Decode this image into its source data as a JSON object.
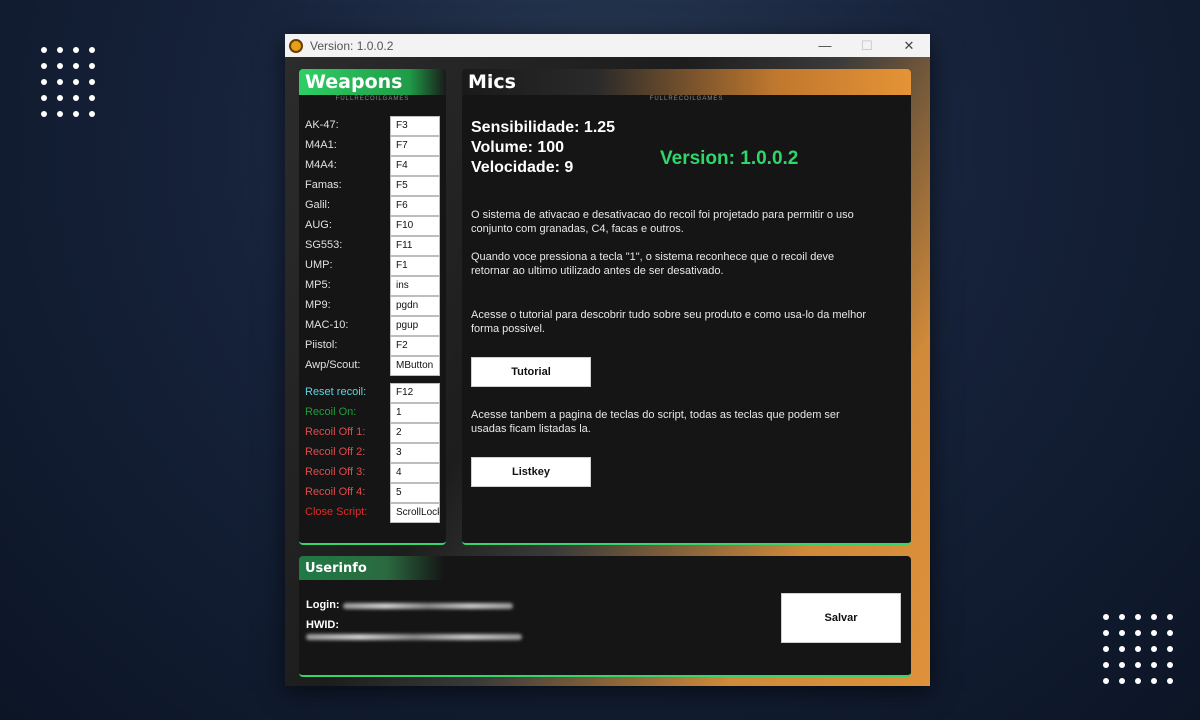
{
  "window": {
    "title": "Version: 1.0.0.2",
    "controls": {
      "minimize": "—",
      "maximize": "☐",
      "close": "✕"
    }
  },
  "weapons": {
    "title": "Weapons",
    "brand": "FULLRECOILGAMES",
    "items": [
      {
        "label": "AK-47:",
        "key": "F3"
      },
      {
        "label": "M4A1:",
        "key": "F7"
      },
      {
        "label": "M4A4:",
        "key": "F4"
      },
      {
        "label": "Famas:",
        "key": "F5"
      },
      {
        "label": "Galil:",
        "key": "F6"
      },
      {
        "label": "AUG:",
        "key": "F10"
      },
      {
        "label": "SG553:",
        "key": "F11"
      },
      {
        "label": "UMP:",
        "key": "F1"
      },
      {
        "label": "MP5:",
        "key": "ins"
      },
      {
        "label": "MP9:",
        "key": "pgdn"
      },
      {
        "label": "MAC-10:",
        "key": "pgup"
      },
      {
        "label": "Piistol:",
        "key": "F2"
      },
      {
        "label": "Awp/Scout:",
        "key": "MButton"
      }
    ],
    "controls": [
      {
        "label": "Reset recoil:",
        "key": "F12",
        "color": "#5fd4e0"
      },
      {
        "label": "Recoil On:",
        "key": "1",
        "color": "#1e9e3a"
      },
      {
        "label": "Recoil Off 1:",
        "key": "2",
        "color": "#e04b4b"
      },
      {
        "label": "Recoil Off 2:",
        "key": "3",
        "color": "#e04b4b"
      },
      {
        "label": "Recoil Off 3:",
        "key": "4",
        "color": "#e04b4b"
      },
      {
        "label": "Recoil Off 4:",
        "key": "5",
        "color": "#e04b4b"
      },
      {
        "label": "Close Script:",
        "key": "ScrollLock",
        "color": "#e02a2a"
      }
    ]
  },
  "mics": {
    "title": "Mics",
    "brand": "FULLRECOILGAMES",
    "sensibilidade": "Sensibilidade: 1.25",
    "volume": "Volume: 100",
    "velocidade": "Velocidade: 9",
    "version": "Version: 1.0.0.2",
    "para1": "O sistema de ativacao e desativacao do recoil foi projetado para permitir o uso conjunto com granadas, C4, facas e outros.",
    "para2": "Quando voce pressiona a tecla \"1\", o sistema reconhece que o recoil deve retornar ao ultimo utilizado antes de ser desativado.",
    "para3": "Acesse o tutorial para descobrir tudo sobre seu produto e como usa-lo da melhor forma possivel.",
    "tutorial_button": "Tutorial",
    "para4": "Acesse tanbem a pagina de teclas do script, todas as teclas que podem ser usadas ficam listadas la.",
    "listkey_button": "Listkey"
  },
  "userinfo": {
    "title": "Userinfo",
    "login_label": "Login:",
    "hwid_label": "HWID:",
    "save_button": "Salvar"
  },
  "colors": {
    "accent_green": "#2fd66b",
    "accent_orange": "#e59336",
    "panel_bg": "#151515"
  }
}
